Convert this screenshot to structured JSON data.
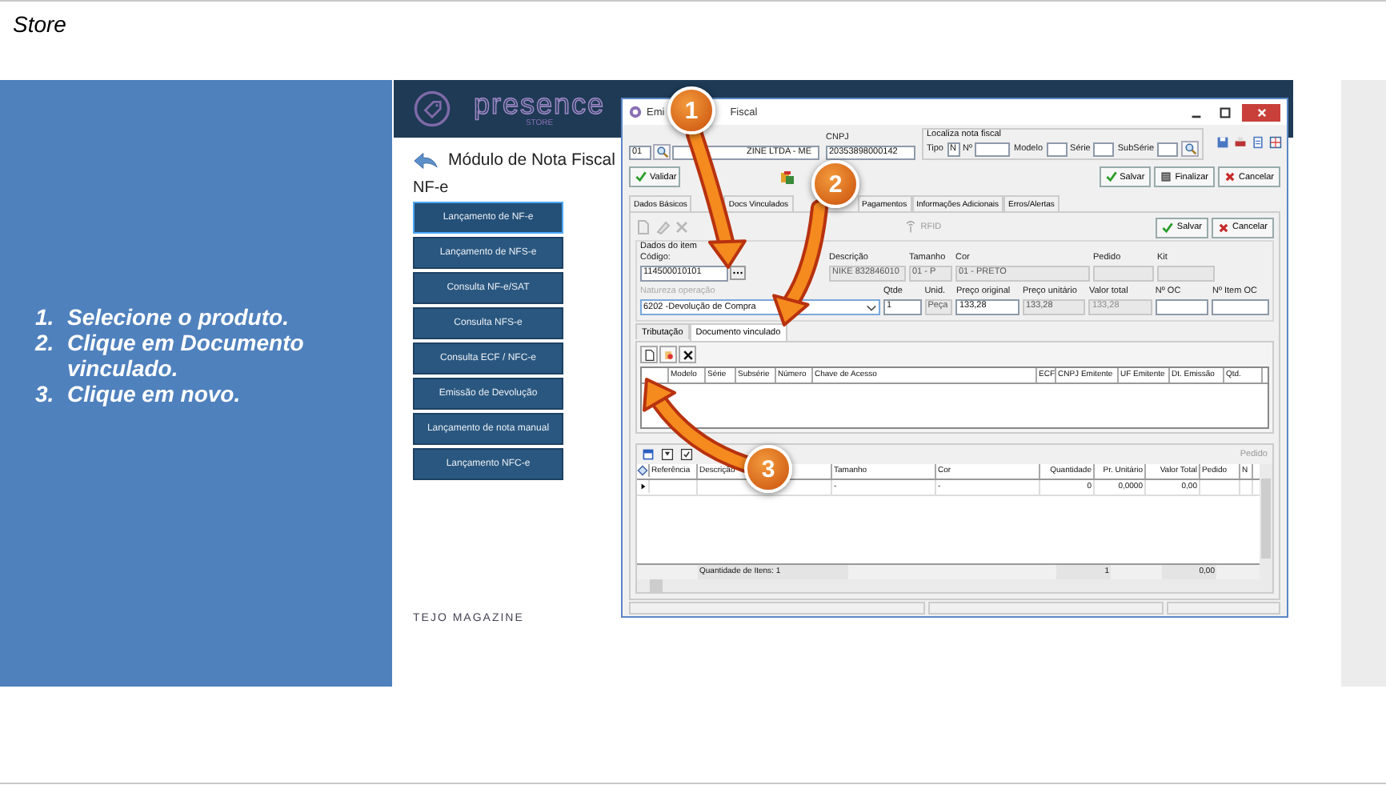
{
  "page_title": "Store",
  "steps": [
    {
      "number": "1.",
      "text": "Selecione o produto."
    },
    {
      "number": "2.",
      "text": "Clique em Documento vinculado."
    },
    {
      "number": "3.",
      "text": "Clique em novo."
    }
  ],
  "app": {
    "brand": "presence",
    "brand_sub": "STORE",
    "module_title": "Módulo de Nota Fiscal",
    "section": "NF-e",
    "menu": [
      {
        "label": "Lançamento de NF-e",
        "selected": true
      },
      {
        "label": "Lançamento de NFS-e",
        "selected": false
      },
      {
        "label": "Consulta NF-e/SAT",
        "selected": false
      },
      {
        "label": "Consulta NFS-e",
        "selected": false
      },
      {
        "label": "Consulta ECF / NFC-e",
        "selected": false
      },
      {
        "label": "Emissão de Devolução",
        "selected": false
      },
      {
        "label": "Lançamento de nota manual",
        "selected": false
      },
      {
        "label": "Lançamento NFC-e",
        "selected": false
      }
    ],
    "footer": "TEJO MAGAZINE"
  },
  "dialog": {
    "title_parts": [
      "Emi",
      "Fiscal"
    ],
    "code": "01",
    "company": "ZINE LTDA - ME",
    "cnpj_label": "CNPJ",
    "cnpj": "20353898000142",
    "locate_label": "Localiza nota fiscal",
    "locate_fields": [
      {
        "label": "Tipo",
        "value": "N"
      },
      {
        "label": "Nº"
      },
      {
        "label": "Modelo"
      },
      {
        "label": "Série"
      },
      {
        "label": "SubSérie"
      }
    ],
    "validate": "Validar",
    "save": "Salvar",
    "finish": "Finalizar",
    "cancel": "Cancelar",
    "tabs": [
      {
        "label": "Dados Básicos",
        "selected": false
      },
      {
        "label": "Docs Vinculados",
        "selected": false
      },
      {
        "label": "Pagamentos",
        "selected": false
      },
      {
        "label": "Informações Adicionais",
        "selected": false
      },
      {
        "label": "Erros/Alertas",
        "selected": false
      }
    ],
    "rfid": "RFID",
    "item_save": "Salvar",
    "item_cancel": "Cancelar",
    "item_legend": "Dados do item",
    "row_a": [
      {
        "label": "Código:",
        "value": "114500010101",
        "kind": "lookup"
      },
      {
        "label": "Descrição",
        "value": "NIKE 832846010",
        "kind": "readonly"
      },
      {
        "label": "Tamanho",
        "value": "01 - P",
        "kind": "readonly"
      },
      {
        "label": "Cor",
        "value": "01 - PRETO",
        "kind": "readonly"
      },
      {
        "label": "Pedido",
        "kind": "group"
      },
      {
        "label": "Kit",
        "kind": "group"
      }
    ],
    "row_b": [
      {
        "label": "Natureza operação",
        "value": "6202 -Devolução de Compra",
        "kind": "select"
      },
      {
        "label": "Qtde",
        "value": "1",
        "kind": "input"
      },
      {
        "label": "Unid.",
        "value": "Peça",
        "kind": "readonly"
      },
      {
        "label": "Preço original",
        "value": "133,28",
        "kind": "input"
      },
      {
        "label": "Preço unitário",
        "value": "133,28",
        "kind": "readonly"
      },
      {
        "label": "Valor total",
        "value": "133,28",
        "kind": "disabled"
      },
      {
        "label": "Nº OC",
        "kind": "input"
      },
      {
        "label": "Nº Item OC",
        "kind": "input"
      }
    ],
    "subtabs": [
      {
        "label": "Tributação",
        "selected": false
      },
      {
        "label": "Documento vinculado",
        "selected": true
      }
    ],
    "doc_columns": [
      "Modelo",
      "Série",
      "Subsérie",
      "Número",
      "Chave de Acesso",
      "ECF",
      "CNPJ Emitente",
      "UF Emitente",
      "Dt. Emissão",
      "Qtd."
    ],
    "items_label": "Pedido",
    "item_columns": [
      "Referência",
      "Descrição",
      "Tamanho",
      "Cor",
      "Quantidade",
      "Pr. Unitário",
      "Valor Total",
      "Pedido",
      "N"
    ],
    "item_row": {
      "tamanho": "-",
      "cor": "-",
      "quantidade": "0",
      "unitario": "0,0000",
      "total": "0,00"
    },
    "footer_count": "Quantidade de Itens: 1",
    "footer_qty": "1",
    "footer_total": "0,00"
  },
  "callouts": [
    "1",
    "2",
    "3"
  ]
}
